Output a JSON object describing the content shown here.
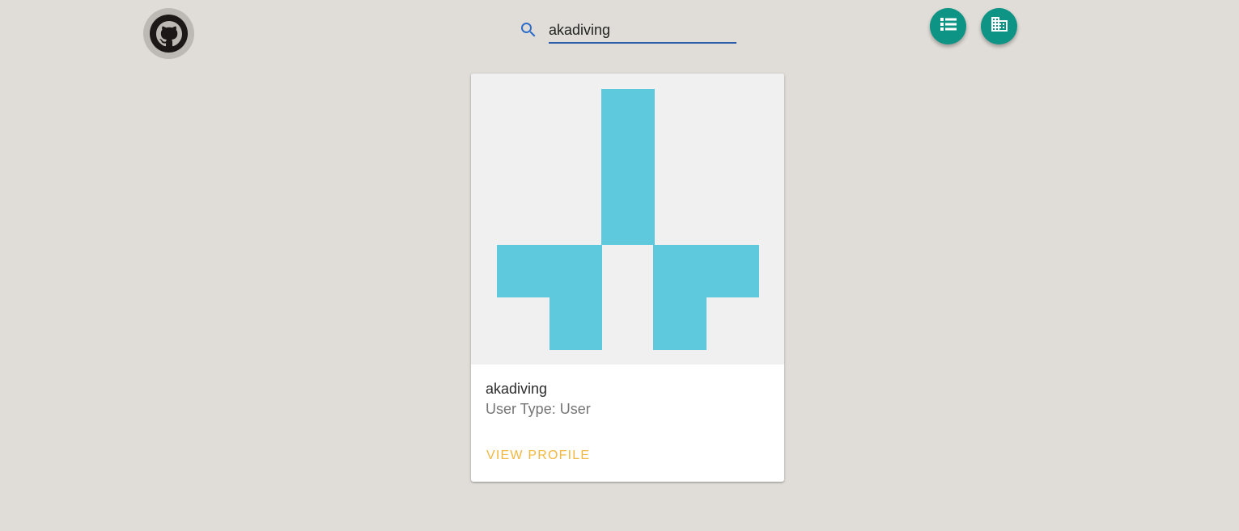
{
  "header": {
    "logo_icon": "github-icon",
    "search": {
      "value": "akadiving",
      "icon": "search-icon"
    },
    "actions": [
      {
        "icon": "list-icon"
      },
      {
        "icon": "building-icon"
      }
    ]
  },
  "results": [
    {
      "avatar_icon": "identicon",
      "avatar_color": "#5ec9dc",
      "name": "akadiving",
      "user_type": "User Type: User",
      "action_label": "VIEW PROFILE"
    }
  ],
  "colors": {
    "background": "#e0ddd8",
    "fab": "#0e9485",
    "accent": "#f1b740",
    "input_underline": "#2a5ca8"
  }
}
